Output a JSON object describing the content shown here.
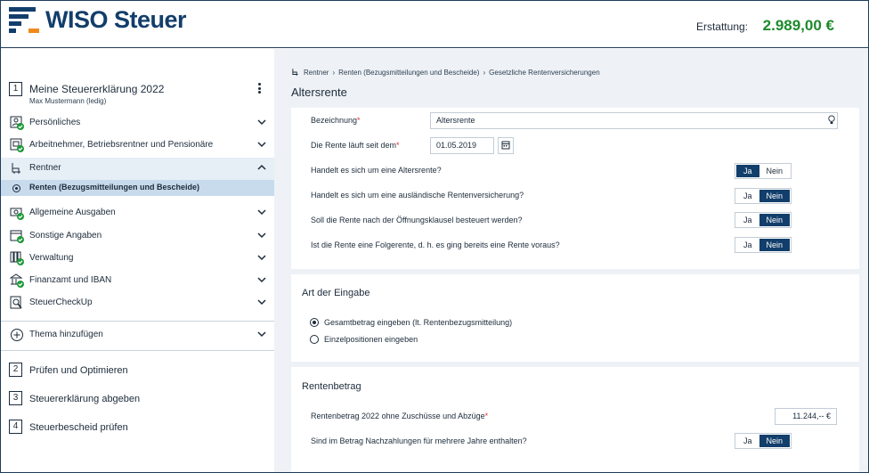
{
  "header": {
    "brand": "WISO Steuer",
    "refund_label": "Erstattung:",
    "refund_value": "2.989,00 €",
    "colors": {
      "brand": "#123e6b",
      "accent": "#f08a1c",
      "refund": "#1d8a2c"
    }
  },
  "sidebar": {
    "step1": {
      "number": "1",
      "title": "Meine Steuererklärung 2022",
      "subtitle": "Max Mustermann (ledig)"
    },
    "items": [
      {
        "label": "Persönliches",
        "icon": "person-check-icon"
      },
      {
        "label": "Arbeitnehmer, Betriebsrentner und Pensionäre",
        "icon": "worker-check-icon"
      },
      {
        "label": "Rentner",
        "icon": "chair-icon"
      },
      {
        "label": "Allgemeine Ausgaben",
        "icon": "money-check-icon"
      },
      {
        "label": "Sonstige Angaben",
        "icon": "calendar-check-icon"
      },
      {
        "label": "Verwaltung",
        "icon": "binders-check-icon"
      },
      {
        "label": "Finanzamt und IBAN",
        "icon": "building-check-icon"
      },
      {
        "label": "SteuerCheckUp",
        "icon": "magnifier-doc-icon"
      }
    ],
    "sub_item": "Renten (Bezugsmitteilungen und Bescheide)",
    "add_topic": "Thema hinzufügen",
    "steps": [
      {
        "number": "2",
        "title": "Prüfen und Optimieren"
      },
      {
        "number": "3",
        "title": "Steuererklärung abgeben"
      },
      {
        "number": "4",
        "title": "Steuerbescheid prüfen"
      }
    ]
  },
  "main": {
    "breadcrumb": [
      "Rentner",
      "Renten (Bezugsmitteilungen und Bescheide)",
      "Gesetzliche Rentenversicherungen"
    ],
    "title": "Altersrente",
    "form": {
      "bezeichnung_label": "Bezeichnung",
      "bezeichnung_value": "Altersrente",
      "since_label": "Die Rente läuft seit dem",
      "since_value": "01.05.2019",
      "questions": [
        {
          "text": "Handelt es sich um eine Altersrente?",
          "selected": "Ja"
        },
        {
          "text": "Handelt es sich um eine ausländische Rentenversicherung?",
          "selected": "Nein"
        },
        {
          "text": "Soll die Rente nach der Öffnungsklausel besteuert werden?",
          "selected": "Nein"
        },
        {
          "text": "Ist die Rente eine Folgerente, d. h. es ging bereits eine Rente voraus?",
          "selected": "Nein"
        }
      ],
      "yes": "Ja",
      "no": "Nein"
    },
    "input_type": {
      "title": "Art der Eingabe",
      "options": [
        "Gesamtbetrag eingeben (lt. Rentenbezugsmitteilung)",
        "Einzelpositionen eingeben"
      ],
      "selected_index": 0
    },
    "amount": {
      "title": "Rentenbetrag",
      "amount_label": "Rentenbetrag 2022 ohne Zuschüsse und Abzüge",
      "amount_value": "11.244,-- €",
      "arrears_label": "Sind im Betrag Nachzahlungen für mehrere Jahre enthalten?",
      "arrears_selected": "Nein"
    }
  }
}
